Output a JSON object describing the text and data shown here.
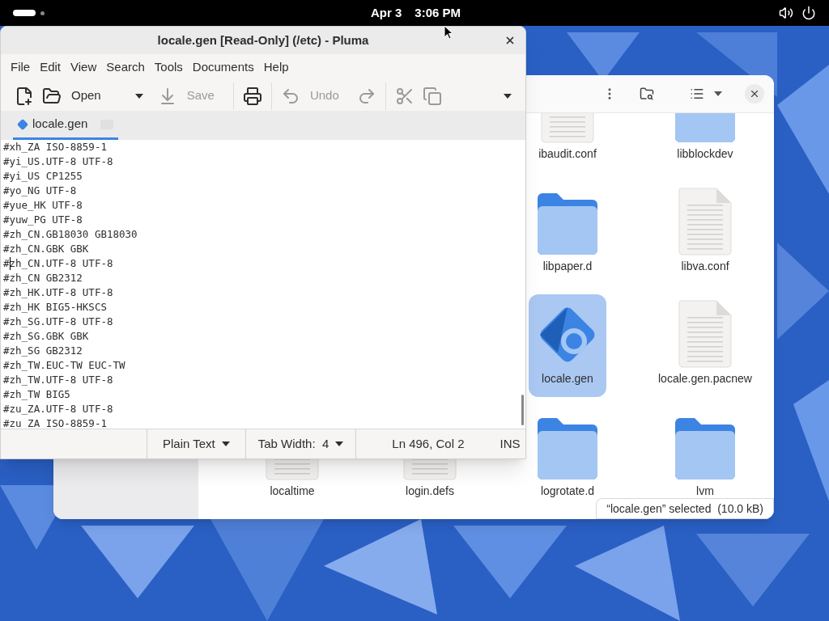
{
  "top_bar": {
    "date": "Apr 3",
    "time": "3:06 PM"
  },
  "files_window": {
    "rows": [
      [
        {
          "name": "ibaudit.conf",
          "kind": "document",
          "selected": false
        },
        {
          "name": "libblockdev",
          "kind": "folder",
          "selected": false
        }
      ],
      [
        {
          "name": "libpaper.d",
          "kind": "folder",
          "selected": false
        },
        {
          "name": "libva.conf",
          "kind": "document",
          "selected": false
        }
      ],
      [
        {
          "name": "locale.gen",
          "kind": "config",
          "selected": true
        },
        {
          "name": "locale.gen.pacnew",
          "kind": "document",
          "selected": false
        }
      ],
      [
        {
          "name": "localtime",
          "kind": "document",
          "selected": false
        },
        {
          "name": "login.defs",
          "kind": "document",
          "selected": false
        },
        {
          "name": "logrotate.d",
          "kind": "folder",
          "selected": false
        },
        {
          "name": "lvm",
          "kind": "folder",
          "selected": false
        }
      ]
    ],
    "status": "“locale.gen” selected  (10.0 kB)"
  },
  "editor": {
    "title": "locale.gen [Read-Only] (/etc) - Pluma",
    "menu": [
      "File",
      "Edit",
      "View",
      "Search",
      "Tools",
      "Documents",
      "Help"
    ],
    "toolbar": [
      {
        "kind": "new",
        "disabled": false
      },
      {
        "kind": "open",
        "label": "Open",
        "disabled": false
      },
      {
        "kind": "recent",
        "disabled": false
      },
      {
        "kind": "save",
        "label": "Save",
        "disabled": true
      },
      {
        "kind": "print",
        "disabled": false
      },
      {
        "kind": "undo",
        "label": "Undo",
        "disabled": true
      },
      {
        "kind": "redo",
        "disabled": true
      },
      {
        "kind": "cut",
        "disabled": true
      },
      {
        "kind": "copy",
        "disabled": true
      },
      {
        "kind": "more",
        "disabled": false
      }
    ],
    "tabs": [
      {
        "label": "locale.gen",
        "selected": true
      }
    ],
    "lines": [
      {
        "text": "#xh_ZA ISO-8859-1",
        "cursor": false
      },
      {
        "text": "#yi_US.UTF-8 UTF-8",
        "cursor": false
      },
      {
        "text": "#yi_US CP1255",
        "cursor": false
      },
      {
        "text": "#yo_NG UTF-8",
        "cursor": false
      },
      {
        "text": "#yue_HK UTF-8",
        "cursor": false
      },
      {
        "text": "#yuw_PG UTF-8",
        "cursor": false
      },
      {
        "text": "#zh_CN.GB18030 GB18030",
        "cursor": false
      },
      {
        "text": "#zh_CN.GBK GBK",
        "cursor": false
      },
      {
        "text": "#zh_CN.UTF-8 UTF-8",
        "cursor": true
      },
      {
        "text": "#zh_CN GB2312",
        "cursor": false
      },
      {
        "text": "#zh_HK.UTF-8 UTF-8",
        "cursor": false
      },
      {
        "text": "#zh_HK BIG5-HKSCS",
        "cursor": false
      },
      {
        "text": "#zh_SG.UTF-8 UTF-8",
        "cursor": false
      },
      {
        "text": "#zh_SG.GBK GBK",
        "cursor": false
      },
      {
        "text": "#zh_SG GB2312",
        "cursor": false
      },
      {
        "text": "#zh_TW.EUC-TW EUC-TW",
        "cursor": false
      },
      {
        "text": "#zh_TW.UTF-8 UTF-8",
        "cursor": false
      },
      {
        "text": "#zh_TW BIG5",
        "cursor": false
      },
      {
        "text": "#zu_ZA.UTF-8 UTF-8",
        "cursor": false
      },
      {
        "text": "#zu_ZA ISO-8859-1",
        "cursor": false
      }
    ],
    "status_bar": {
      "language": "Plain Text",
      "tab_width": "Tab Width:  4",
      "position": "Ln 496, Col 2",
      "mode": "INS"
    }
  }
}
